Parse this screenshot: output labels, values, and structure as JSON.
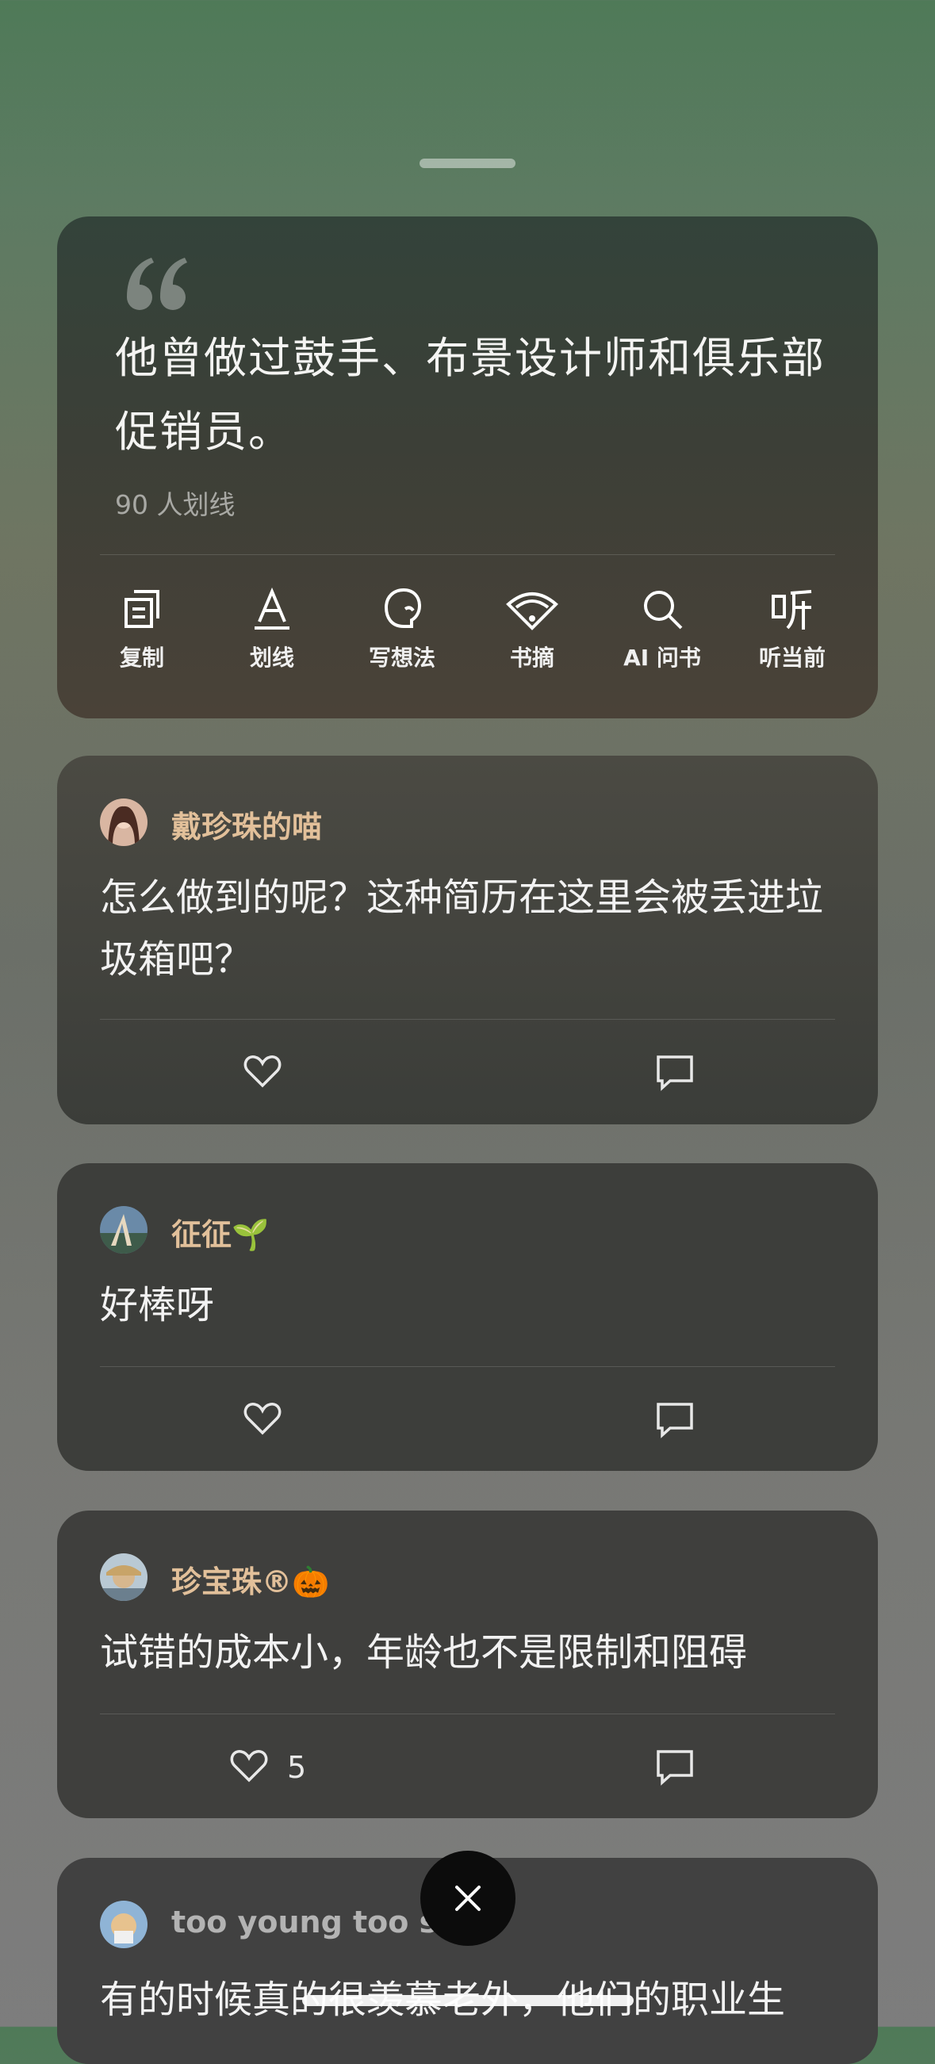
{
  "quote": {
    "text": "他曾做过鼓手、布景设计师和俱乐部促销员。",
    "highlight_count": "90 人划线"
  },
  "actions": [
    {
      "label": "复制",
      "icon": "copy-icon"
    },
    {
      "label": "划线",
      "icon": "underline-icon"
    },
    {
      "label": "写想法",
      "icon": "thought-icon"
    },
    {
      "label": "书摘",
      "icon": "excerpt-icon"
    },
    {
      "label": "AI 问书",
      "icon": "search-icon"
    },
    {
      "label": "听当前",
      "icon": "listen-icon"
    }
  ],
  "comments": [
    {
      "user": "戴珍珠的喵",
      "text": "怎么做到的呢？这种简历在这里会被丢进垃圾箱吧？",
      "likes": ""
    },
    {
      "user": "征征🌱",
      "text": "好棒呀",
      "likes": ""
    },
    {
      "user": "珍宝珠®🎃",
      "text": "试错的成本小，年龄也不是限制和阻碍",
      "likes": "5"
    },
    {
      "user": "too young too si",
      "text": "有的时候真的很羡慕老外，他们的职业生",
      "likes": ""
    }
  ],
  "colors": {
    "username": "#e2c09a",
    "card_bg": "#3d3e3b",
    "bg_top": "#4f7a58"
  }
}
